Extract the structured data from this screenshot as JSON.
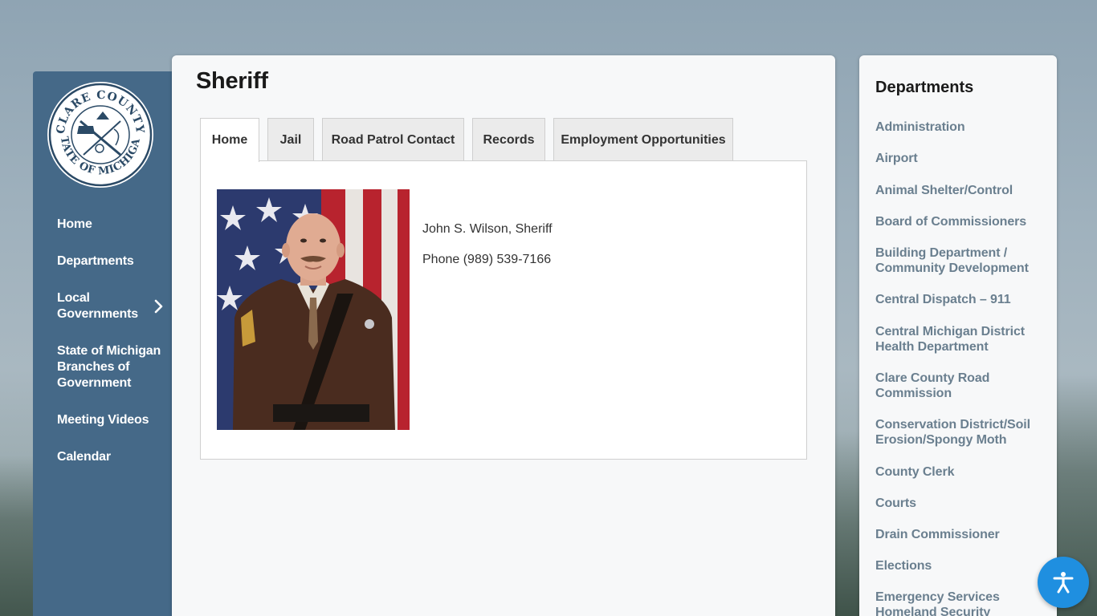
{
  "nav": {
    "seal_alt": "Clare County State of Michigan seal",
    "seal_top_text": "CLARE COUNTY",
    "seal_bottom_text": "STATE OF MICHIGAN",
    "items": [
      {
        "label": "Home"
      },
      {
        "label": "Departments"
      },
      {
        "label": "Local Governments"
      },
      {
        "label": "State of Michigan Branches of Government"
      },
      {
        "label": "Meeting Videos"
      },
      {
        "label": "Calendar"
      }
    ]
  },
  "main": {
    "title": "Sheriff",
    "tabs": [
      {
        "label": "Home",
        "active": true
      },
      {
        "label": "Jail"
      },
      {
        "label": "Road Patrol Contact"
      },
      {
        "label": "Records"
      },
      {
        "label": "Employment Opportunities"
      }
    ],
    "name_line": "John S. Wilson, Sheriff",
    "phone_line": "Phone (989) 539-7166"
  },
  "sidebar": {
    "title": "Departments",
    "links": [
      "Administration",
      "Airport",
      "Animal Shelter/Control",
      "Board of Commissioners",
      "Building Department / Community Development",
      "Central Dispatch – 911",
      "Central Michigan District Health Department",
      "Clare County Road Commission",
      "Conservation District/Soil Erosion/Spongy Moth",
      "County Clerk",
      "Courts",
      "Drain Commissioner",
      "Elections",
      "Emergency Services Homeland Security"
    ]
  },
  "colors": {
    "nav_bg": "#456988",
    "link": "#6a7f8f",
    "accessibility_button": "#1f8fe0"
  },
  "icons": {
    "nav_expand": "chevron-right-icon",
    "accessibility": "accessibility-icon"
  }
}
